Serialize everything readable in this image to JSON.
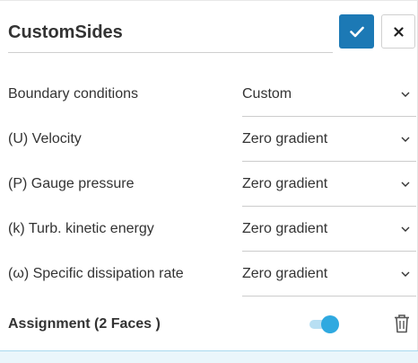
{
  "header": {
    "name_value": "CustomSides",
    "confirm_icon": "check-icon",
    "close_icon": "close-icon"
  },
  "rows": [
    {
      "label": "Boundary conditions",
      "value": "Custom"
    },
    {
      "label": "(U) Velocity",
      "value": "Zero gradient"
    },
    {
      "label": "(P) Gauge pressure",
      "value": "Zero gradient"
    },
    {
      "label": "(k) Turb. kinetic energy",
      "value": "Zero gradient"
    },
    {
      "label": "(ω) Specific dissipation rate",
      "value": "Zero gradient"
    }
  ],
  "assignment": {
    "label": "Assignment (2 Faces )",
    "toggle_on": true,
    "delete_icon": "trash-icon"
  },
  "colors": {
    "accent": "#1c79b5",
    "toggle": "#2fa9e0",
    "text": "#333333"
  }
}
